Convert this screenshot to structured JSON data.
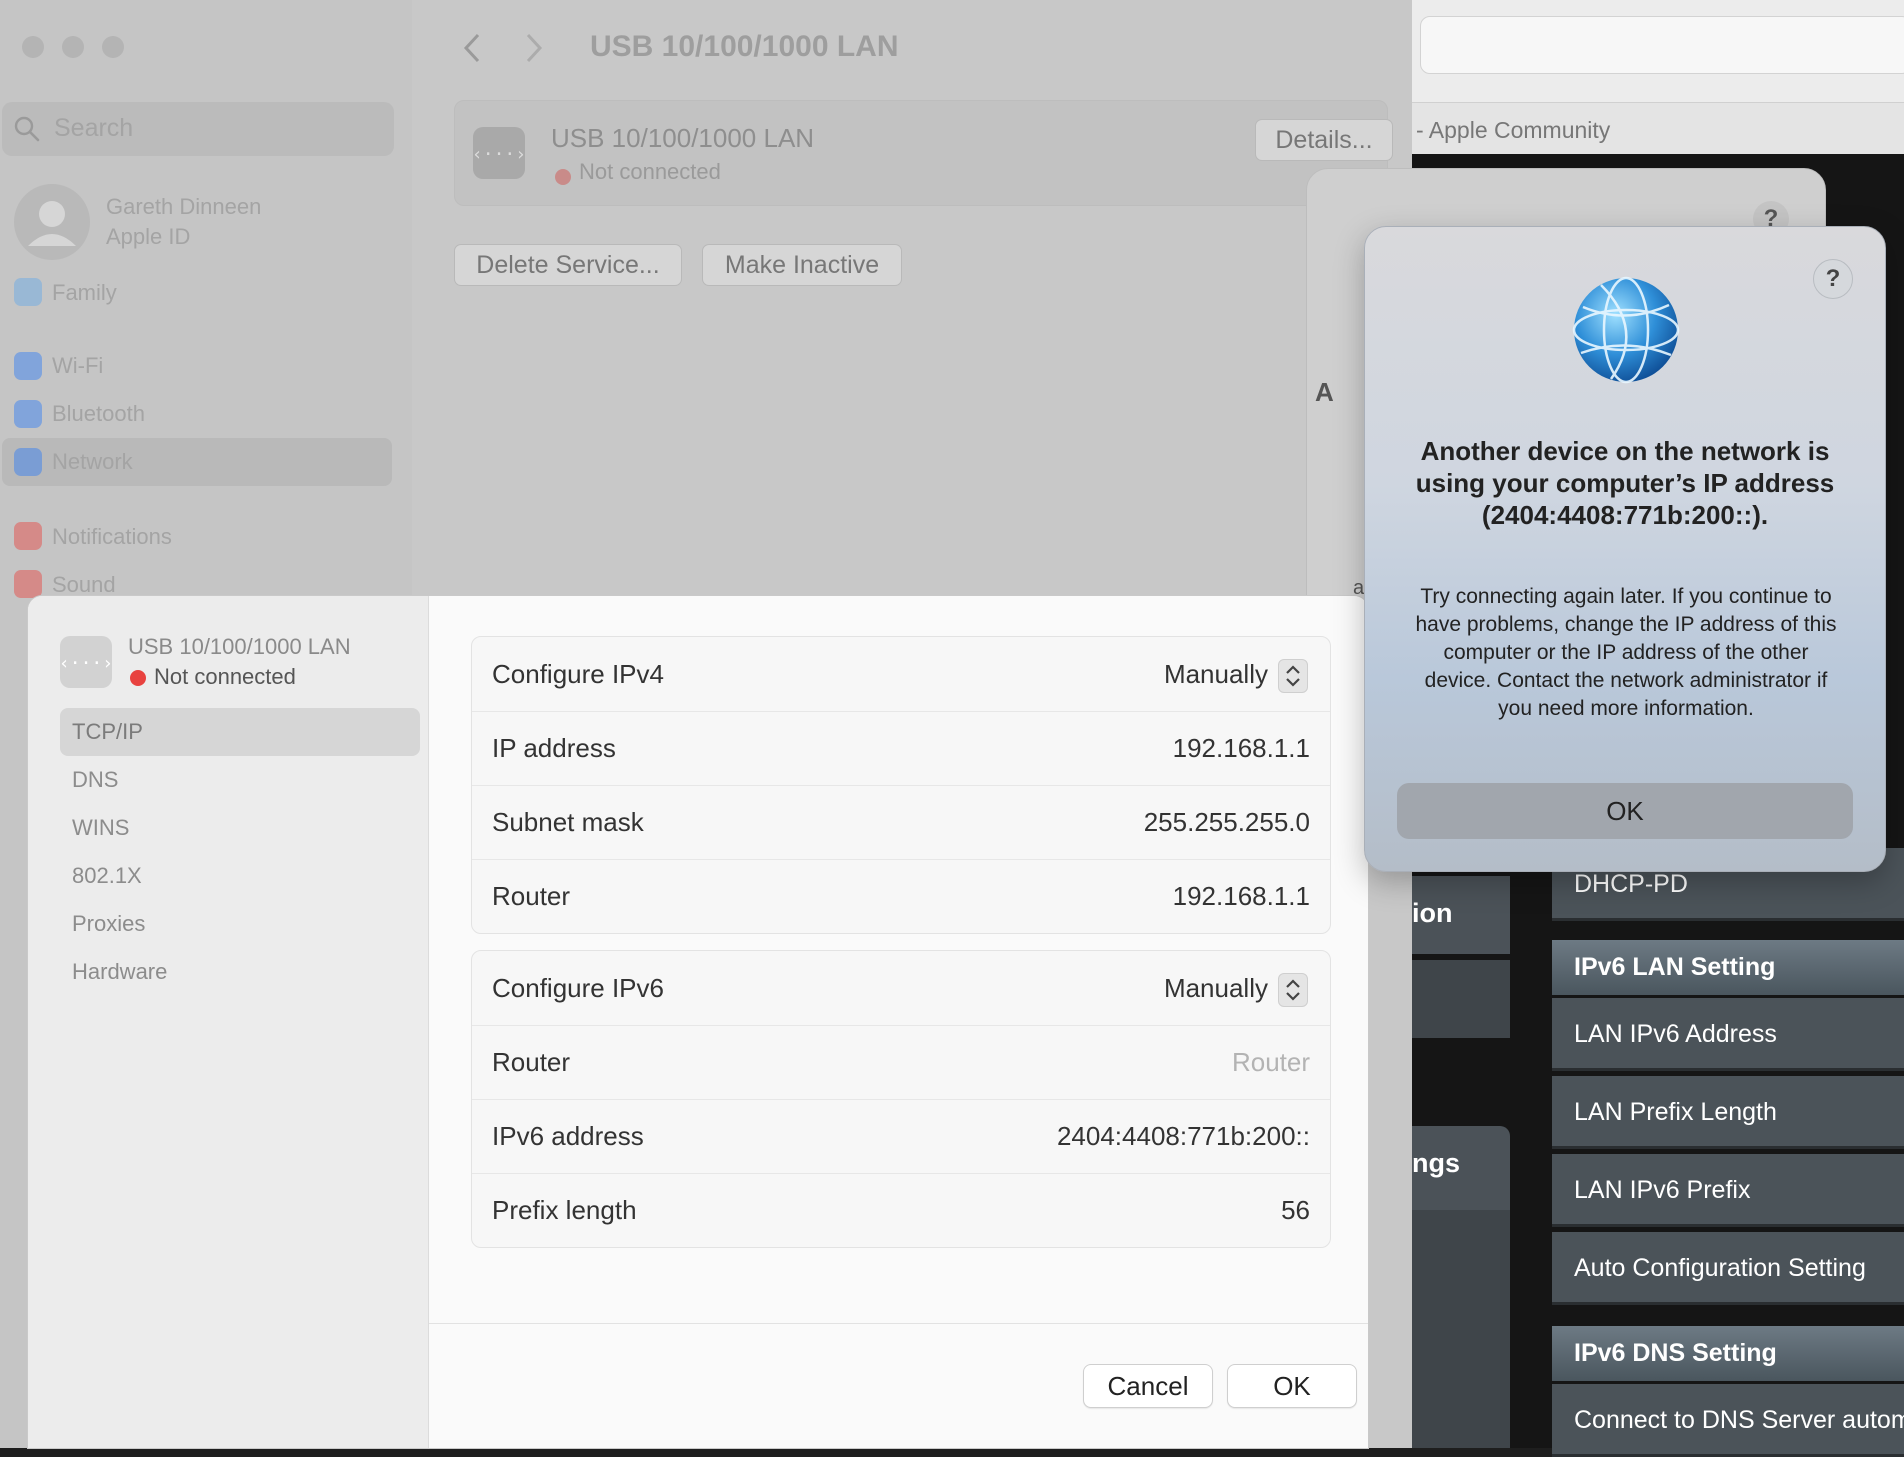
{
  "browser": {
    "tab_title": "- Apple Community",
    "side_fragments": [
      "ion",
      "ngs"
    ],
    "menu": {
      "dhcp_pd": "DHCP-PD",
      "lan_header": "IPv6 LAN Setting",
      "lan_items": [
        "LAN IPv6 Address",
        "LAN Prefix Length",
        "LAN IPv6 Prefix",
        "Auto Configuration Setting"
      ],
      "dns_header": "IPv6 DNS Setting",
      "dns_items": [
        "Connect to DNS Server automa"
      ]
    }
  },
  "settings": {
    "search_placeholder": "Search",
    "user": {
      "name": "Gareth Dinneen",
      "subtitle": "Apple ID"
    },
    "sidebar_items": [
      {
        "label": "Family",
        "icon": "family-icon",
        "color": "#64a8e8"
      },
      {
        "label": "Wi-Fi",
        "icon": "wifi-icon",
        "color": "#2f7cf6"
      },
      {
        "label": "Bluetooth",
        "icon": "bluetooth-icon",
        "color": "#2f7cf6"
      },
      {
        "label": "Network",
        "icon": "globe-icon",
        "color": "#2f7cf6"
      },
      {
        "label": "Notifications",
        "icon": "bell-icon",
        "color": "#e8423f"
      },
      {
        "label": "Sound",
        "icon": "speaker-icon",
        "color": "#e8423f"
      }
    ],
    "toolbar_title": "USB 10/100/1000 LAN",
    "service": {
      "name": "USB 10/100/1000 LAN",
      "status": "Not connected",
      "details_button": "Details..."
    },
    "delete_button": "Delete Service...",
    "inactive_button": "Make Inactive"
  },
  "sheet": {
    "service_name": "USB 10/100/1000 LAN",
    "service_status": "Not connected",
    "status_color": "#e8423f",
    "tabs": [
      "TCP/IP",
      "DNS",
      "WINS",
      "802.1X",
      "Proxies",
      "Hardware"
    ],
    "selected_tab": "TCP/IP",
    "ipv4": [
      {
        "label": "Configure IPv4",
        "value": "Manually"
      },
      {
        "label": "IP address",
        "value": "192.168.1.1"
      },
      {
        "label": "Subnet mask",
        "value": "255.255.255.0"
      },
      {
        "label": "Router",
        "value": "192.168.1.1"
      }
    ],
    "ipv6": [
      {
        "label": "Configure IPv6",
        "value": "Manually"
      },
      {
        "label": "Router",
        "placeholder": "Router"
      },
      {
        "label": "IPv6 address",
        "value": "2404:4408:771b:200::"
      },
      {
        "label": "Prefix length",
        "value": "56"
      }
    ],
    "cancel_button": "Cancel",
    "ok_button": "OK"
  },
  "alert": {
    "help": "?",
    "title": "Another device on the network is using your computer’s IP address (2404:4408:771b:200::).",
    "message": "Try connecting again later. If you continue to have problems, change the IP address of this computer or the IP address of the other device. Contact the network administrator if you need more information.",
    "ok_button": "OK"
  },
  "back_alert": {
    "help": "?",
    "visible_chars": [
      "A",
      "a"
    ]
  }
}
